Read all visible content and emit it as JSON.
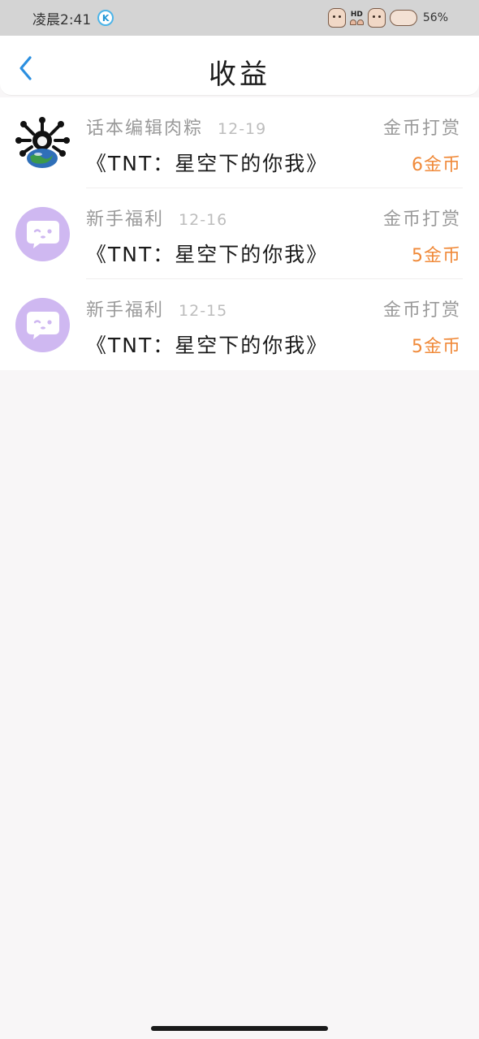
{
  "status_bar": {
    "time": "凌晨2:41",
    "badge_letter": "K",
    "hd_label": "HD",
    "battery": "56%"
  },
  "header": {
    "title": "收益"
  },
  "colors": {
    "accent_blue": "#2b8fe0",
    "amount_orange": "#f08a3a",
    "avatar_purple": "#cfb8f1"
  },
  "records": [
    {
      "source": "话本编辑肉粽",
      "date": "12-19",
      "type": "金币打赏",
      "book": "《TNT：星空下的你我》",
      "amount": "6金币",
      "avatar": "planet-avatar"
    },
    {
      "source": "新手福利",
      "date": "12-16",
      "type": "金币打赏",
      "book": "《TNT：星空下的你我》",
      "amount": "5金币",
      "avatar": "chat-bubble-avatar"
    },
    {
      "source": "新手福利",
      "date": "12-15",
      "type": "金币打赏",
      "book": "《TNT：星空下的你我》",
      "amount": "5金币",
      "avatar": "chat-bubble-avatar"
    }
  ]
}
